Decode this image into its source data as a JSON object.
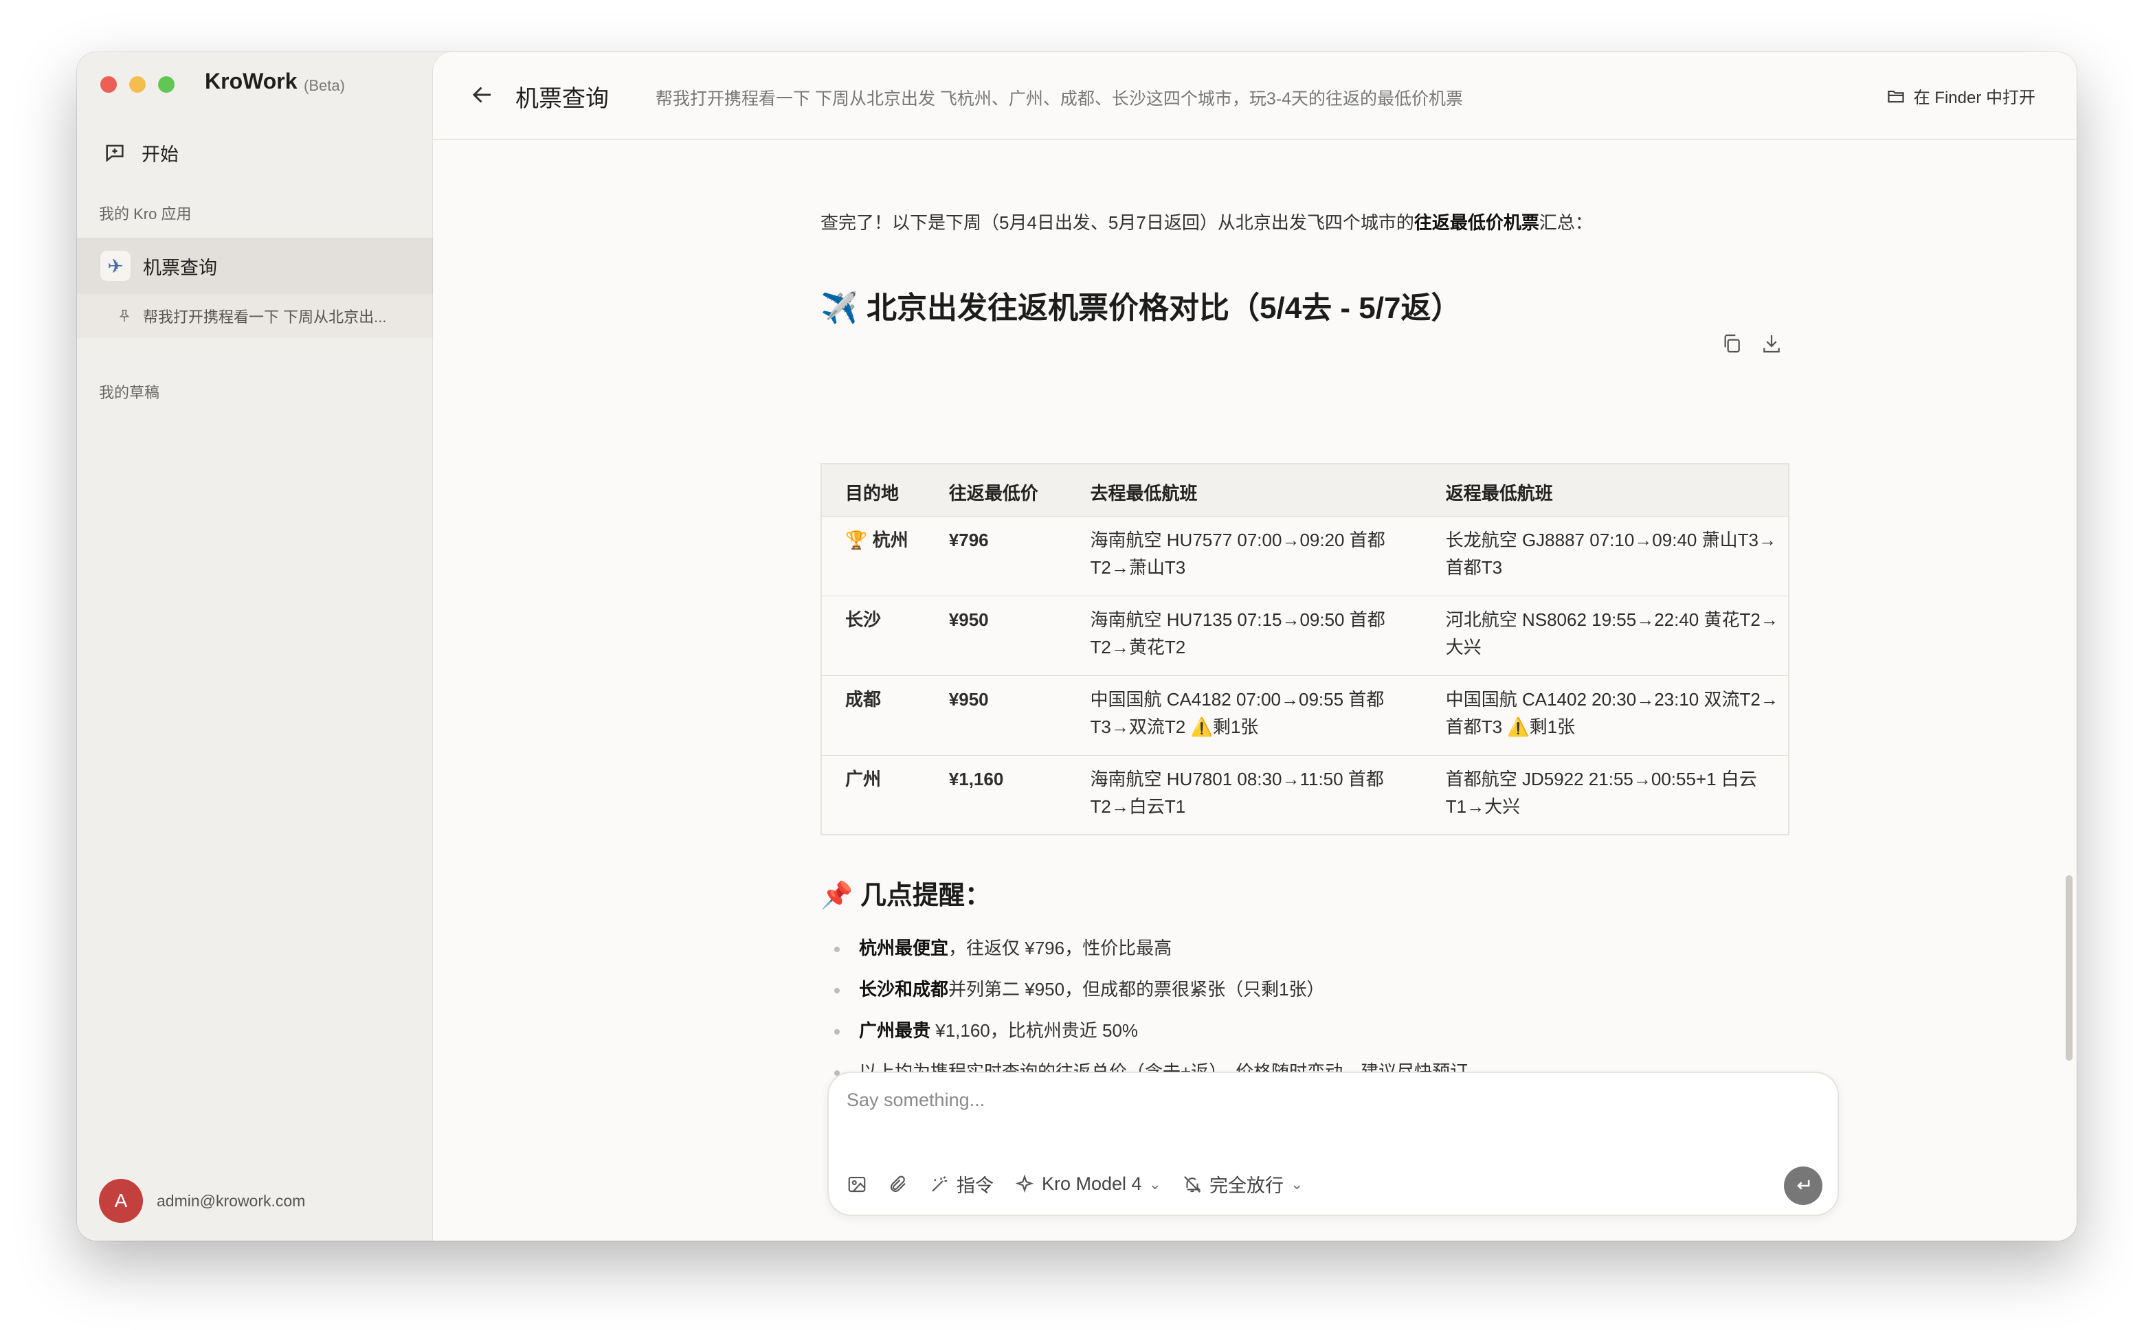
{
  "sidebar": {
    "app_name": "KroWork",
    "app_tag": "(Beta)",
    "start_label": "开始",
    "section_apps": "我的 Kro 应用",
    "active_app": "机票查询",
    "session_title": "帮我打开携程看一下 下周从北京出...",
    "section_drafts": "我的草稿",
    "user_initial": "A",
    "user_email": "admin@krowork.com"
  },
  "header": {
    "title": "机票查询",
    "subtitle": "帮我打开携程看一下 下周从北京出发 飞杭州、广州、成都、长沙这四个城市，玩3-4天的往返的最低价机票",
    "finder_label": "在 Finder 中打开"
  },
  "content": {
    "intro_prefix": "查完了！以下是下周（5月4日出发、5月7日返回）从北京出发飞四个城市的",
    "intro_bold": "往返最低价机票",
    "intro_suffix": "汇总：",
    "heading": "✈️ 北京出发往返机票价格对比（5/4去 - 5/7返）",
    "table": {
      "headers": [
        "目的地",
        "往返最低价",
        "去程最低航班",
        "返程最低航班"
      ],
      "rows": [
        [
          "🏆 杭州",
          "¥796",
          "海南航空 HU7577 07:00→09:20 首都T2→萧山T3",
          "长龙航空 GJ8887 07:10→09:40 萧山T3→首都T3"
        ],
        [
          "长沙",
          "¥950",
          "海南航空 HU7135 07:15→09:50 首都T2→黄花T2",
          "河北航空 NS8062 19:55→22:40 黄花T2→大兴"
        ],
        [
          "成都",
          "¥950",
          "中国国航 CA4182 07:00→09:55 首都T3→双流T2 ⚠️剩1张",
          "中国国航 CA1402 20:30→23:10 双流T2→首都T3 ⚠️剩1张"
        ],
        [
          "广州",
          "¥1,160",
          "海南航空 HU7801 08:30→11:50 首都T2→白云T1",
          "首都航空 JD5922 21:55→00:55+1 白云T1→大兴"
        ]
      ]
    },
    "tips_heading": "📌 几点提醒：",
    "tips": [
      {
        "bold": "杭州最便宜",
        "text": "，往返仅 ¥796，性价比最高"
      },
      {
        "bold": "长沙和成都",
        "text": "并列第二 ¥950，但成都的票很紧张（只剩1张）"
      },
      {
        "bold": "广州最贵",
        "text": " ¥1,160，比杭州贵近 50%"
      },
      {
        "bold": "",
        "text": "以上均为携程实时查询的往返总价（含去+返），价格随时变动，建议尽快预订"
      }
    ]
  },
  "composer": {
    "placeholder": "Say something...",
    "command_label": "指令",
    "model_label": "Kro Model 4",
    "permission_label": "完全放行"
  }
}
